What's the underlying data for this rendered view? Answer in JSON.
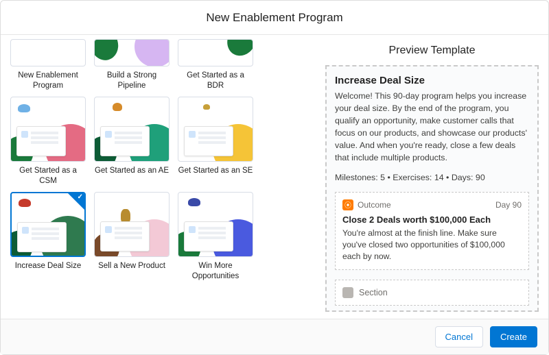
{
  "modal": {
    "title": "New Enablement Program"
  },
  "templates": [
    {
      "label": "New Enablement Program"
    },
    {
      "label": "Build a Strong Pipeline"
    },
    {
      "label": "Get Started as a BDR"
    },
    {
      "label": "Get Started as a CSM"
    },
    {
      "label": "Get Started as an AE"
    },
    {
      "label": "Get Started as an SE"
    },
    {
      "label": "Increase Deal Size",
      "selected": true
    },
    {
      "label": "Sell a New Product"
    },
    {
      "label": "Win More Opportunities"
    }
  ],
  "preview": {
    "pane_title": "Preview Template",
    "title": "Increase Deal Size",
    "description": "Welcome! This 90-day program helps you increase your deal size. By the end of the program, you qualify an opportunity, make customer calls that focus on our products, and showcase our products' value. And when you're ready, close a few deals that include multiple products.",
    "meta": "Milestones: 5  •  Exercises: 14  •  Days: 90",
    "outcome_tag": "Outcome",
    "outcome_day": "Day 90",
    "outcome_title": "Close 2 Deals worth $100,000 Each",
    "outcome_desc": "You're almost at the finish line. Make sure you've closed two opportunities of $100,000 each by now.",
    "section_label": "Section"
  },
  "footer": {
    "cancel": "Cancel",
    "create": "Create"
  }
}
